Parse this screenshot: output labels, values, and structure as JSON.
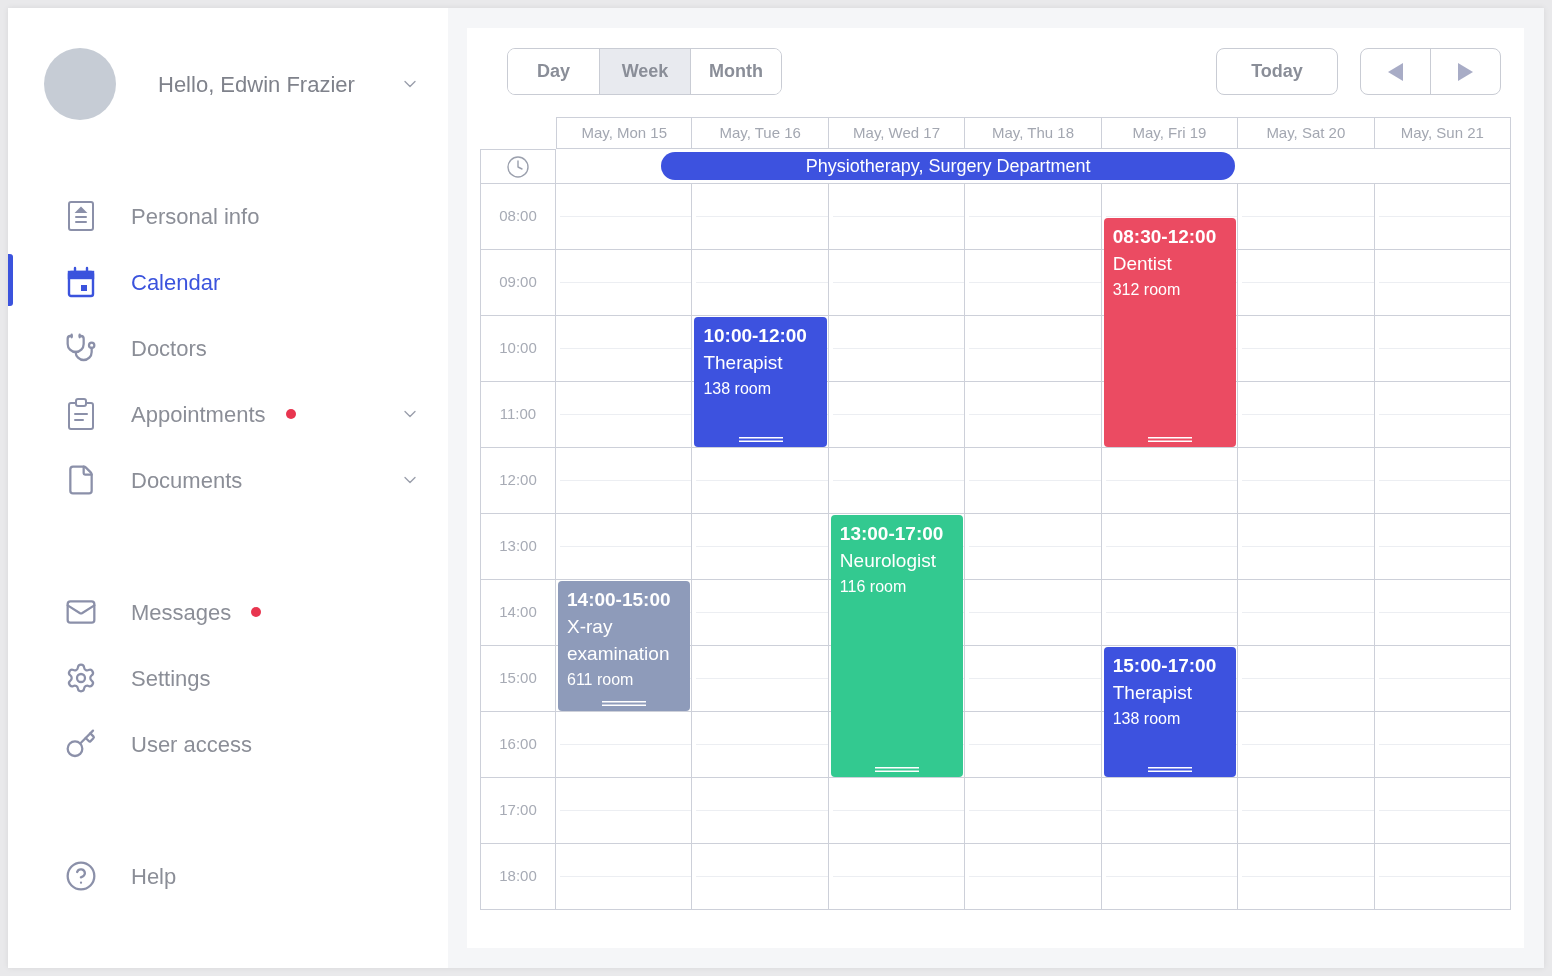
{
  "sidebar": {
    "user": {
      "greeting": "Hello, Edwin Frazier"
    },
    "sections": [
      {
        "items": [
          {
            "label": "Personal info",
            "selected": false,
            "notification": false,
            "expandable": false
          },
          {
            "label": "Calendar",
            "selected": true,
            "notification": false,
            "expandable": false
          },
          {
            "label": "Doctors",
            "selected": false,
            "notification": false,
            "expandable": false
          },
          {
            "label": "Appointments",
            "selected": false,
            "notification": true,
            "expandable": true
          },
          {
            "label": "Documents",
            "selected": false,
            "notification": false,
            "expandable": true
          }
        ]
      },
      {
        "items": [
          {
            "label": "Messages",
            "selected": false,
            "notification": true,
            "expandable": false
          },
          {
            "label": "Settings",
            "selected": false,
            "notification": false,
            "expandable": false
          },
          {
            "label": "User access",
            "selected": false,
            "notification": false,
            "expandable": false
          }
        ]
      },
      {
        "items": [
          {
            "label": "Help",
            "selected": false,
            "notification": false,
            "expandable": false
          }
        ]
      }
    ]
  },
  "calendar": {
    "view_tabs": [
      {
        "label": "Day",
        "selected": false
      },
      {
        "label": "Week",
        "selected": true
      },
      {
        "label": "Month",
        "selected": false
      }
    ],
    "today_button": "Today",
    "days": [
      {
        "label": "May, Mon 15",
        "events": [
          {
            "time": "14:00-15:00",
            "title": "X-ray examination",
            "room": "611 room",
            "color": "#8e9bba"
          }
        ]
      },
      {
        "label": "May, Tue 16",
        "events": [
          {
            "time": "10:00-12:00",
            "title": "Therapist",
            "room": "138 room",
            "color": "#3d52df"
          }
        ]
      },
      {
        "label": "May, Wed 17",
        "events": [
          {
            "time": "13:00-17:00",
            "title": "Neurologist",
            "room": "116 room",
            "color": "#33c990"
          }
        ]
      },
      {
        "label": "May, Thu 18"
      },
      {
        "label": "May, Fri 19",
        "events": [
          {
            "time": "08:30-12:00",
            "title": "Dentist",
            "room": "312 room",
            "color": "#eb4b62"
          },
          {
            "time": "15:00-17:00",
            "title": "Therapist",
            "room": "138 room",
            "color": "#3d52df"
          }
        ]
      },
      {
        "label": "May, Sat 20"
      },
      {
        "label": "May, Sun 21"
      }
    ],
    "all_day_events": [
      {
        "title": "Physiotherapy, Surgery Department"
      }
    ],
    "hours": [
      "08:00",
      "09:00",
      "10:00",
      "11:00",
      "12:00",
      "13:00",
      "14:00",
      "15:00",
      "16:00",
      "17:00",
      "18:00"
    ]
  }
}
